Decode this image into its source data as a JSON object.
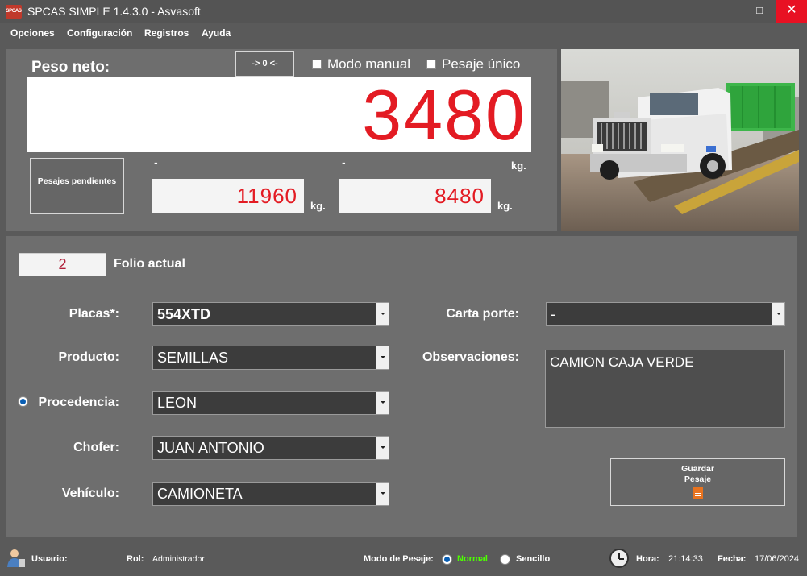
{
  "window": {
    "logo_text": "SPCAS",
    "title": "SPCAS SIMPLE 1.4.3.0 - Asvasoft",
    "minimize_glyph": "_",
    "maximize_glyph": "□",
    "close_glyph": "✕"
  },
  "menu": [
    "Opciones",
    "Configuración",
    "Registros",
    "Ayuda"
  ],
  "weight": {
    "label": "Peso neto:",
    "zero_button": "-> 0 <-",
    "manual_mode": "Modo manual",
    "single_weigh": "Pesaje único",
    "net_value": "3480",
    "pending_button": "Pesajes pendientes",
    "first_dash": "-",
    "second_dash": "-",
    "first_weight": "11960",
    "second_weight": "8480",
    "unit": "kg."
  },
  "form": {
    "folio_value": "2",
    "folio_label": "Folio actual",
    "placas_label": "Placas*:",
    "placas_value": "554XTD",
    "producto_label": "Producto:",
    "producto_value": "SEMILLAS",
    "procedencia_label": "Procedencia:",
    "procedencia_value": "LEON",
    "chofer_label": "Chofer:",
    "chofer_value": "JUAN ANTONIO",
    "vehiculo_label": "Vehículo:",
    "vehiculo_value": "CAMIONETA",
    "carta_label": "Carta porte:",
    "carta_value": "-",
    "obs_label": "Observaciones:",
    "obs_value": "CAMION CAJA VERDE",
    "save_button": "Guardar Pesaje"
  },
  "status": {
    "user_label": "Usuario:",
    "role_label": "Rol:",
    "role_value": "Administrador",
    "mode_label": "Modo de Pesaje:",
    "mode_normal": "Normal",
    "mode_simple": "Sencillo",
    "time_label": "Hora:",
    "time_value": "21:14:33",
    "date_label": "Fecha:",
    "date_value": "17/06/2024"
  },
  "colors": {
    "weight_red": "#e31b23",
    "close_red": "#e81123",
    "normal_green": "#4cff00",
    "radio_blue": "#0a5fb4"
  },
  "icons": {
    "user": "user-icon",
    "clock": "clock-icon",
    "save": "document-icon"
  }
}
